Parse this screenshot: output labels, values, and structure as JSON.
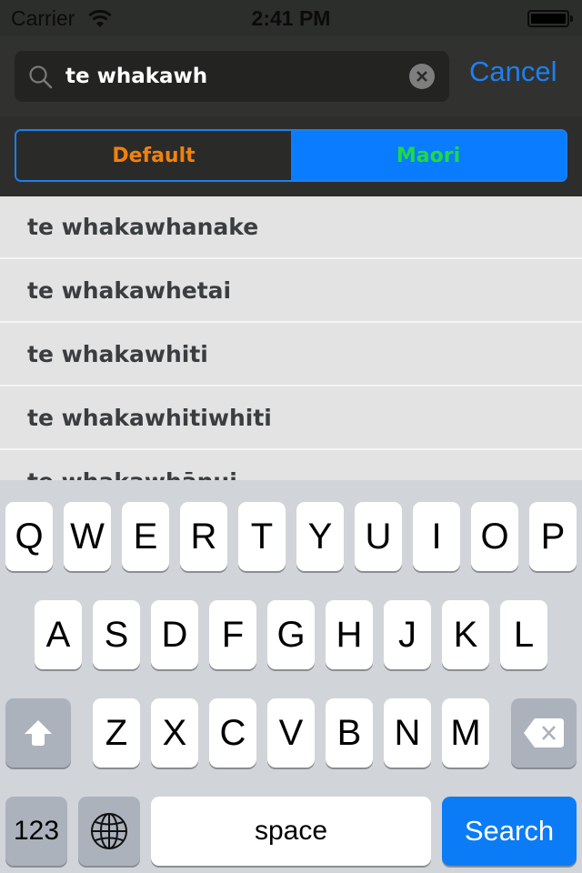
{
  "status_bar": {
    "carrier": "Carrier",
    "time": "2:41 PM",
    "wifi_icon": "wifi-icon",
    "battery_icon": "battery-full-icon"
  },
  "search": {
    "query": "te whakawh",
    "placeholder": "",
    "search_icon": "magnifying-glass-icon",
    "clear_icon": "clear-x-circle-icon",
    "cancel_label": "Cancel"
  },
  "segments": {
    "selected": "Maori",
    "items": [
      {
        "label": "Default",
        "color": "#f0810f",
        "selected": false
      },
      {
        "label": "Maori",
        "color": "#1ddc3e",
        "selected": true
      }
    ],
    "accent": "#0a7cff"
  },
  "results": [
    "te whakawhanake",
    "te whakawhetai",
    "te whakawhiti",
    "te whakawhitiwhiti",
    "te whakawhānui"
  ],
  "keyboard": {
    "row1": [
      "Q",
      "W",
      "E",
      "R",
      "T",
      "Y",
      "U",
      "I",
      "O",
      "P"
    ],
    "row2": [
      "A",
      "S",
      "D",
      "F",
      "G",
      "H",
      "J",
      "K",
      "L"
    ],
    "row3": [
      "Z",
      "X",
      "C",
      "V",
      "B",
      "N",
      "M"
    ],
    "shift_icon": "shift-arrow-icon",
    "backspace_icon": "backspace-icon",
    "numbers_label": "123",
    "globe_icon": "globe-icon",
    "space_label": "space",
    "search_label": "Search",
    "search_color": "#0b7cf5"
  }
}
